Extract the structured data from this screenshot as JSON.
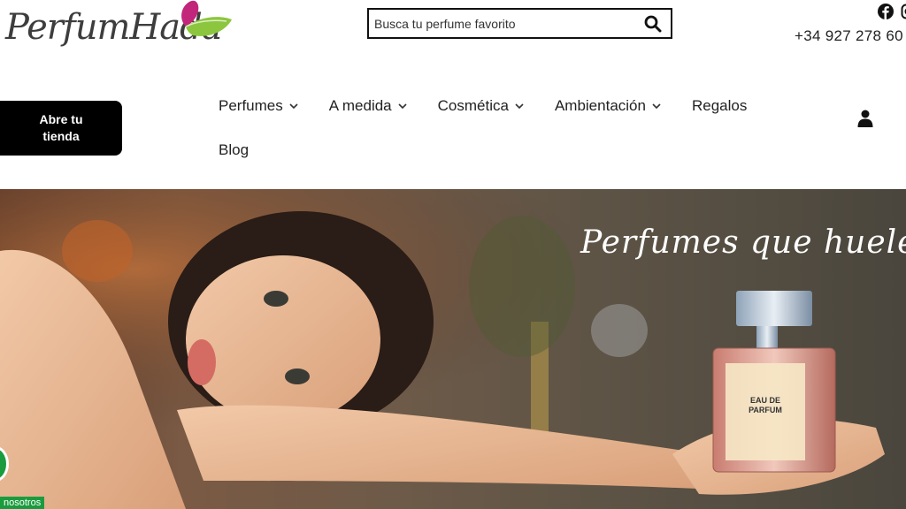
{
  "header": {
    "logo_text": "PerfumHada",
    "search": {
      "placeholder": "Busca tu perfume favorito",
      "value": ""
    },
    "phone": "+34 927 278 60",
    "social_icons": [
      "facebook-icon",
      "instagram-icon"
    ],
    "cta_label_line1": "Abre tu",
    "cta_label_line2": "tienda"
  },
  "nav": {
    "items": [
      {
        "label": "Perfumes",
        "has_dropdown": true
      },
      {
        "label": "A medida",
        "has_dropdown": true
      },
      {
        "label": "Cosmética",
        "has_dropdown": true
      },
      {
        "label": "Ambientación",
        "has_dropdown": true
      },
      {
        "label": "Regalos",
        "has_dropdown": false
      },
      {
        "label": "Blog",
        "has_dropdown": false
      }
    ]
  },
  "hero": {
    "tagline": "Perfumes que huelen a",
    "bottle_label_line1": "EAU DE",
    "bottle_label_line2": "PARFUM"
  },
  "chat": {
    "label": "nosotros"
  },
  "colors": {
    "accent_green": "#1a9c3e",
    "wing_pink": "#c2267a",
    "wing_green": "#8cc63f",
    "button_black": "#000000"
  }
}
